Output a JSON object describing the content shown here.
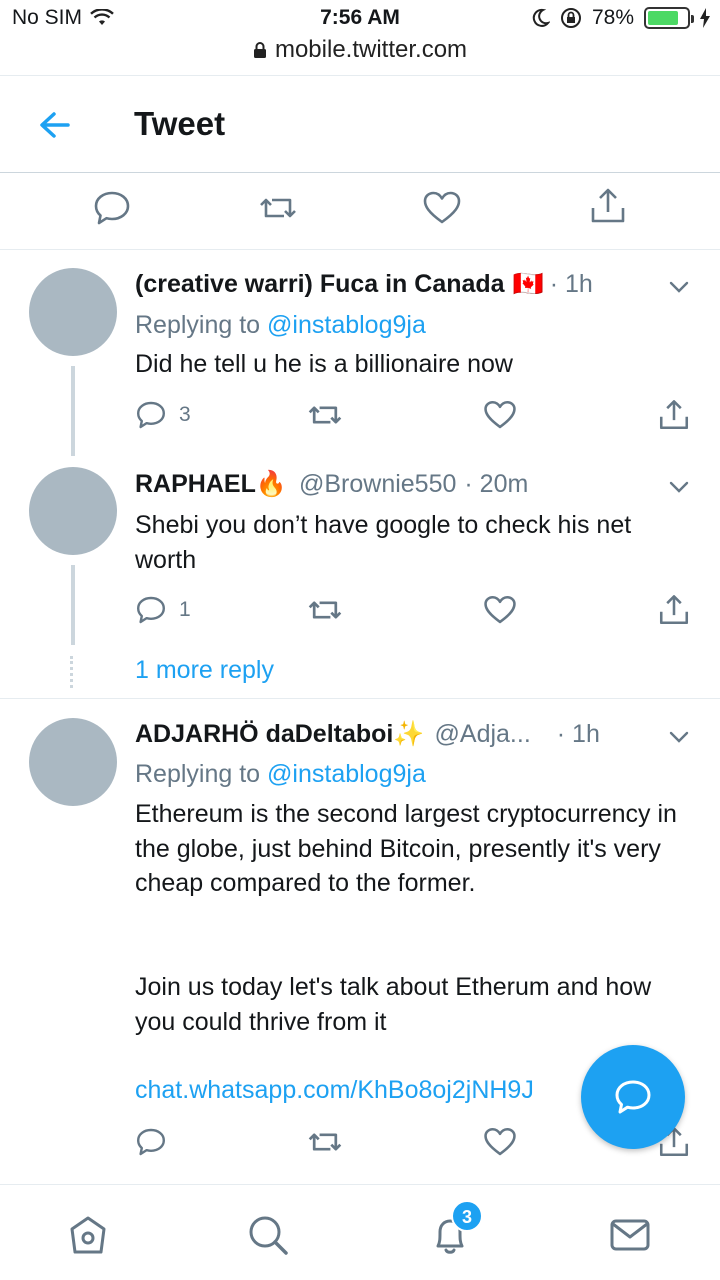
{
  "status_bar": {
    "carrier": "No SIM",
    "time": "7:56 AM",
    "battery_percent": "78%",
    "battery_level": 0.78,
    "url": "mobile.twitter.com"
  },
  "header": {
    "title": "Tweet"
  },
  "tweets": [
    {
      "name": "(creative warri) Fuca in Canada",
      "name_emoji": "🇨🇦",
      "handle": "",
      "time": "· 1h",
      "replying_prefix": "Replying to",
      "replying_to": "@instablog9ja",
      "text": "Did he tell u he is a billionaire now",
      "reply_count": "3"
    },
    {
      "name": "RAPHAEL",
      "name_emoji": "🔥",
      "handle": "@Brownie550",
      "time": "· 20m",
      "text": "Shebi you don’t have google to check his net worth",
      "reply_count": "1"
    },
    {
      "name": "ADJARHÖ daDeltaboi",
      "name_emoji": "✨",
      "handle": "@Adja...",
      "time": "· 1h",
      "replying_prefix": "Replying to",
      "replying_to": "@instablog9ja",
      "text_p1": "Ethereum is the second largest cryptocurrency in the globe, just behind Bitcoin, presently it's very cheap compared to the former.",
      "text_p2": "Join us today let's talk about Etherum and how you could thrive from it",
      "link": "chat.whatsapp.com/KhBo8oj2jNH9J"
    }
  ],
  "more_reply": "1 more reply",
  "notifications_badge": "3",
  "colors": {
    "accent": "#1da1f2",
    "muted": "#657786",
    "avatar": "#aab8c2"
  }
}
